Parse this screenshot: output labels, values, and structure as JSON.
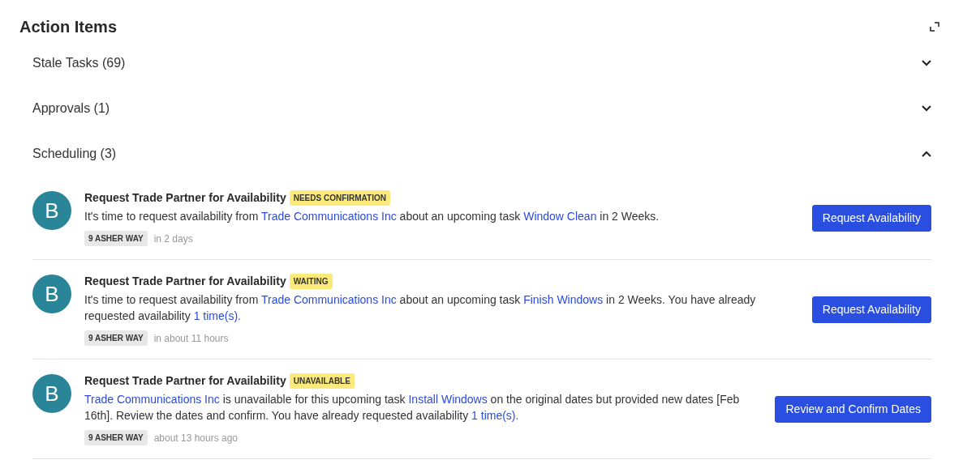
{
  "title": "Action Items",
  "sections": [
    {
      "label": "Stale Tasks (69)",
      "expanded": false
    },
    {
      "label": "Approvals (1)",
      "expanded": false
    },
    {
      "label": "Scheduling (3)",
      "expanded": true,
      "items": [
        {
          "avatar": "B",
          "title": "Request Trade Partner for Availability",
          "status": "NEEDS CONFIRMATION",
          "description": [
            {
              "kind": "text",
              "text": "It's time to request availability from "
            },
            {
              "kind": "link",
              "text": "Trade Communications Inc"
            },
            {
              "kind": "text",
              "text": " about an upcoming task "
            },
            {
              "kind": "link",
              "text": "Window Clean"
            },
            {
              "kind": "text",
              "text": " in 2 Weeks."
            }
          ],
          "location": "9 ASHER WAY",
          "time": "in 2 days",
          "button": "Request Availability"
        },
        {
          "avatar": "B",
          "title": "Request Trade Partner for Availability",
          "status": "WAITING",
          "description": [
            {
              "kind": "text",
              "text": "It's time to request availability from "
            },
            {
              "kind": "link",
              "text": "Trade Communications Inc"
            },
            {
              "kind": "text",
              "text": " about an upcoming task "
            },
            {
              "kind": "link",
              "text": "Finish Windows"
            },
            {
              "kind": "text",
              "text": " in 2 Weeks. You have already requested availability "
            },
            {
              "kind": "link",
              "text": "1 time(s)."
            }
          ],
          "location": "9 ASHER WAY",
          "time": "in about 11 hours",
          "button": "Request Availability"
        },
        {
          "avatar": "B",
          "title": "Request Trade Partner for Availability",
          "status": "UNAVAILABLE",
          "description": [
            {
              "kind": "link",
              "text": "Trade Communications Inc"
            },
            {
              "kind": "text",
              "text": " is unavailable for this upcoming task "
            },
            {
              "kind": "link",
              "text": "Install Windows"
            },
            {
              "kind": "text",
              "text": " on the original dates but provided new dates [Feb 16th]. Review the dates and confirm. You have already requested availability "
            },
            {
              "kind": "link",
              "text": "1 time(s)."
            }
          ],
          "location": "9 ASHER WAY",
          "time": "about 13 hours ago",
          "button": "Review and Confirm Dates"
        }
      ]
    }
  ]
}
